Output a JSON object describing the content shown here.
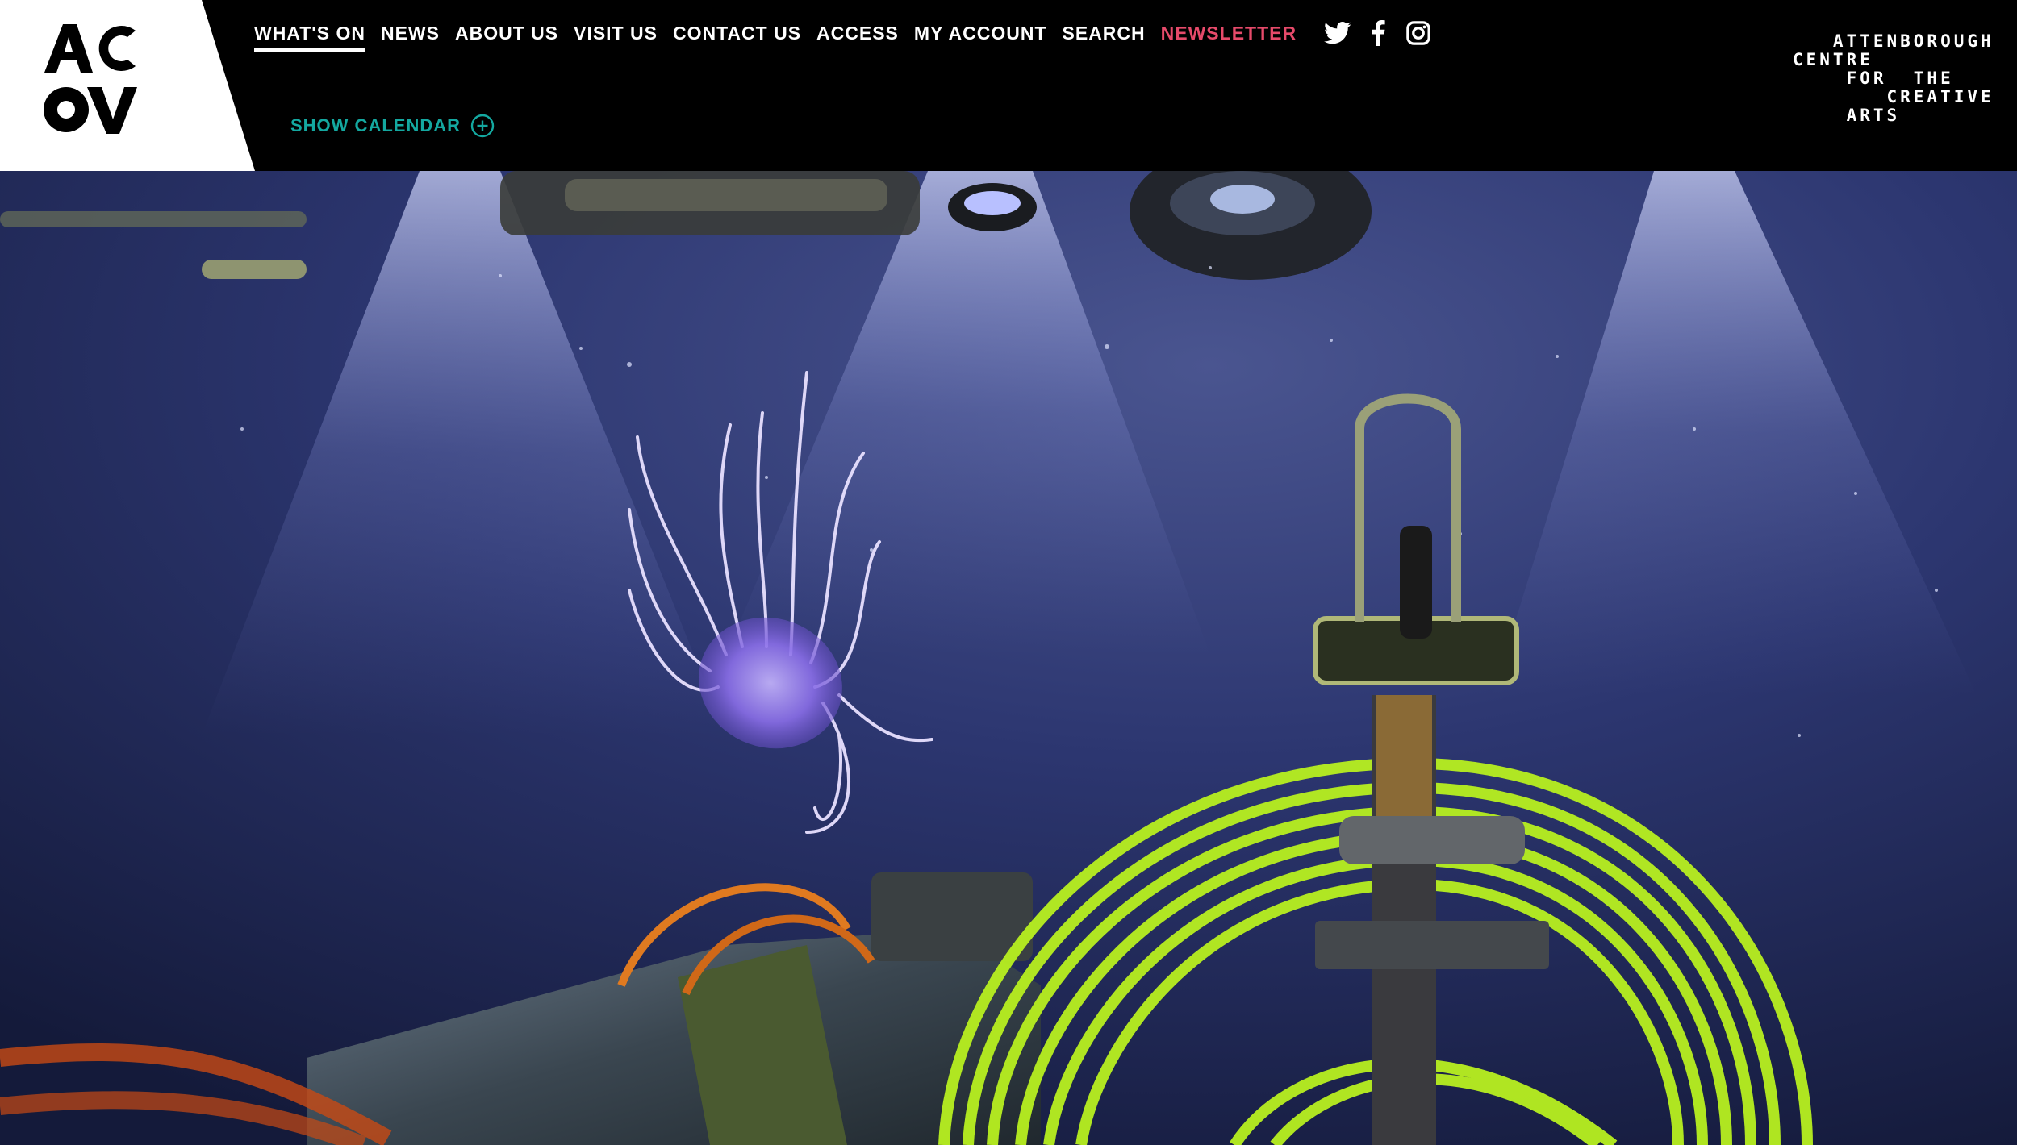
{
  "logo": {
    "letters": [
      "A",
      "C",
      "O",
      "V"
    ],
    "icon": "acca-monogram-logo"
  },
  "nav": {
    "items": [
      {
        "label": "WHAT'S ON",
        "active": true
      },
      {
        "label": "NEWS"
      },
      {
        "label": "ABOUT US"
      },
      {
        "label": "VISIT US"
      },
      {
        "label": "CONTACT US"
      },
      {
        "label": "ACCESS"
      },
      {
        "label": "MY ACCOUNT"
      },
      {
        "label": "SEARCH"
      },
      {
        "label": "NEWSLETTER",
        "highlight": true
      }
    ],
    "social": [
      "twitter-icon",
      "facebook-icon",
      "instagram-icon"
    ]
  },
  "calendar": {
    "label": "SHOW CALENDAR",
    "icon": "plus-circle-icon"
  },
  "brand": {
    "lines": [
      "   ATTENBOROUGH",
      "CENTRE",
      "    FOR  THE",
      "       CREATIVE",
      "    ARTS"
    ]
  },
  "hero": {
    "icon": "deep-sea-jellyfish-photo"
  },
  "colors": {
    "background": "#000000",
    "accent_teal": "#14a8a0",
    "newsletter_pink": "#e64a6a",
    "text": "#ffffff"
  }
}
